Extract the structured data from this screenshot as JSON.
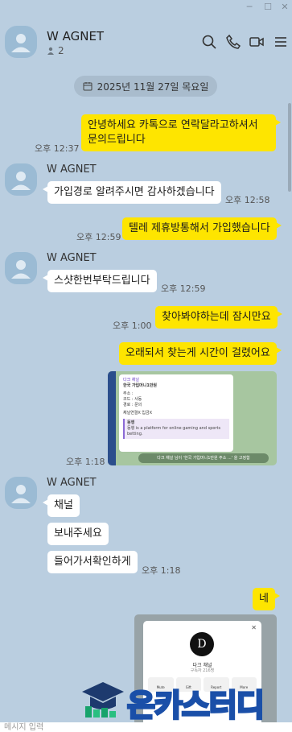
{
  "window": {
    "controls": [
      "minimize",
      "maximize",
      "close"
    ]
  },
  "header": {
    "name": "W AGNET",
    "member_count": "2",
    "icons": [
      "search-icon",
      "call-icon",
      "video-icon",
      "menu-icon"
    ]
  },
  "date_divider": "2025년 11월 27일 목요일",
  "messages": [
    {
      "sender": "me",
      "line1": "안녕하세요 카톡으로 연락달라고하셔서",
      "line2": "문의드립니다",
      "time": "오후 12:37"
    },
    {
      "sender": "W AGNET",
      "text": "가입경로 알려주시면 감사하겠습니다",
      "time": "오후 12:58"
    },
    {
      "sender": "me",
      "text": "텔레 제휴방통해서 가입했습니다",
      "time": "오후 12:59"
    },
    {
      "sender": "W AGNET",
      "text": "스샷한번부탁드립니다",
      "time": "오후 12:59"
    },
    {
      "sender": "me",
      "text": "찾아봐야하는데 잠시만요",
      "time": "오후 1:00"
    },
    {
      "sender": "me",
      "text": "오래되서 찾는게 시간이 걸렸어요"
    },
    {
      "sender": "me",
      "type": "image",
      "time": "오후 1:18"
    },
    {
      "sender": "W AGNET",
      "texts": [
        "채널",
        "보내주세요",
        "들어가서확인하게"
      ],
      "time": "오후 1:18"
    },
    {
      "sender": "me",
      "text": "네"
    },
    {
      "sender": "me",
      "type": "image"
    }
  ],
  "image1": {
    "title": "다크 채널",
    "line1": "한국 가입머니1만원",
    "line2": "주소 :",
    "line3": "코드 : 사동",
    "line4": "경로 : 문의",
    "line5": "채널연결X 입금X",
    "hl_title": "동행",
    "hl_text": "동행 is a platform for online gaming and sports betting.",
    "footer": "다크 채널 님이 '한국 가입머니1만원 주소 ...' 을 고정함"
  },
  "image2": {
    "logo": "D",
    "name": "다크 채널",
    "sub": "구독자 216명",
    "buttons": [
      "Mute",
      "Gift",
      "Report",
      "More"
    ]
  },
  "watermark": {
    "text": "온카스터디"
  },
  "input": {
    "placeholder": "메시지 입력"
  },
  "colors": {
    "background": "#bacee0",
    "my_bubble": "#fee500",
    "other_bubble": "#ffffff",
    "watermark_blue": "#1a4fa8"
  }
}
